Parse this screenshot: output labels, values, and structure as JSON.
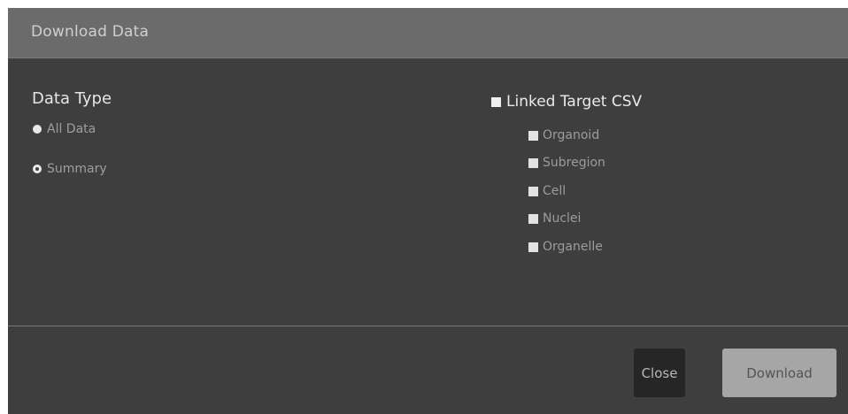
{
  "dialog": {
    "title": "Download Data"
  },
  "data_type": {
    "heading": "Data Type",
    "options": [
      {
        "label": "All Data",
        "selected": false
      },
      {
        "label": "Summary",
        "selected": true
      }
    ]
  },
  "linked_target": {
    "label": "Linked Target CSV",
    "items": [
      {
        "label": "Organoid"
      },
      {
        "label": "Subregion"
      },
      {
        "label": "Cell"
      },
      {
        "label": "Nuclei"
      },
      {
        "label": "Organelle"
      }
    ]
  },
  "footer": {
    "close_label": "Close",
    "download_label": "Download"
  }
}
